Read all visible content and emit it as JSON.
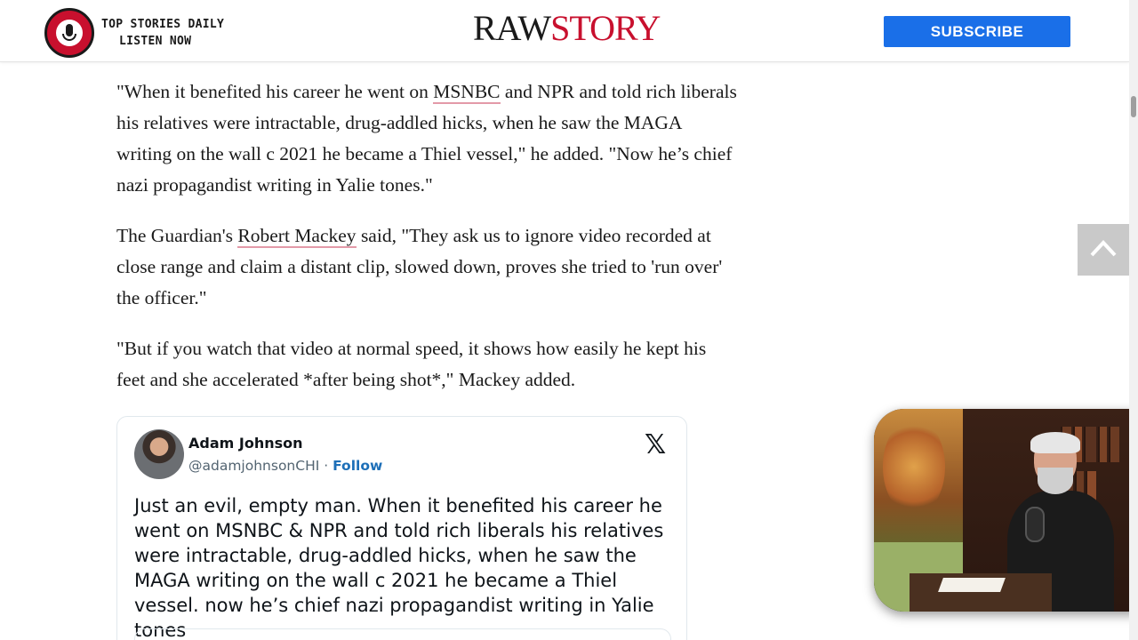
{
  "header": {
    "podcast_line1": "TOP STORIES DAILY",
    "podcast_line2": "LISTEN NOW",
    "logo_part1": "RAW",
    "logo_part2": "STORY",
    "subscribe_label": "SUBSCRIBE"
  },
  "article": {
    "p1": {
      "before": "\"When it benefited his career he went on ",
      "link": "MSNBC",
      "after": " and NPR and told rich liberals his relatives were intractable, drug-addled hicks, when he saw the MAGA writing on the wall c 2021 he became a Thiel vessel,\" he added. \"Now he’s chief nazi propagandist writing in Yalie tones.\""
    },
    "p2": {
      "before": "The Guardian's ",
      "link": "Robert Mackey",
      "after": " said, \"They ask us to ignore video recorded at close range and claim a distant clip, slowed down, proves she tried to 'run over' the officer.\""
    },
    "p3": "\"But if you watch that video at normal speed, it shows how easily he kept his feet and she accelerated *after being shot*,\" Mackey added."
  },
  "tweet": {
    "author": "Adam Johnson",
    "handle": "@adamjohnsonCHI",
    "separator": " · ",
    "follow_label": "Follow",
    "x_logo": "𝕏",
    "text": "Just an evil, empty man. When it benefited his career he went on MSNBC & NPR and told rich liberals his relatives were intractable, drug-addled hicks, when he saw the MAGA writing on the wall c 2021 he became a Thiel vessel. now he’s chief nazi propagandist writing in Yalie tones"
  },
  "colors": {
    "accent_red": "#c8102e",
    "subscribe_blue": "#1a6fe8",
    "follow_blue": "#1d6fb8",
    "link_underline": "#e39aa8"
  },
  "icons": {
    "back_to_top": "chevron-up-icon",
    "podcast": "microphone-icon",
    "x": "x-logo-icon"
  }
}
